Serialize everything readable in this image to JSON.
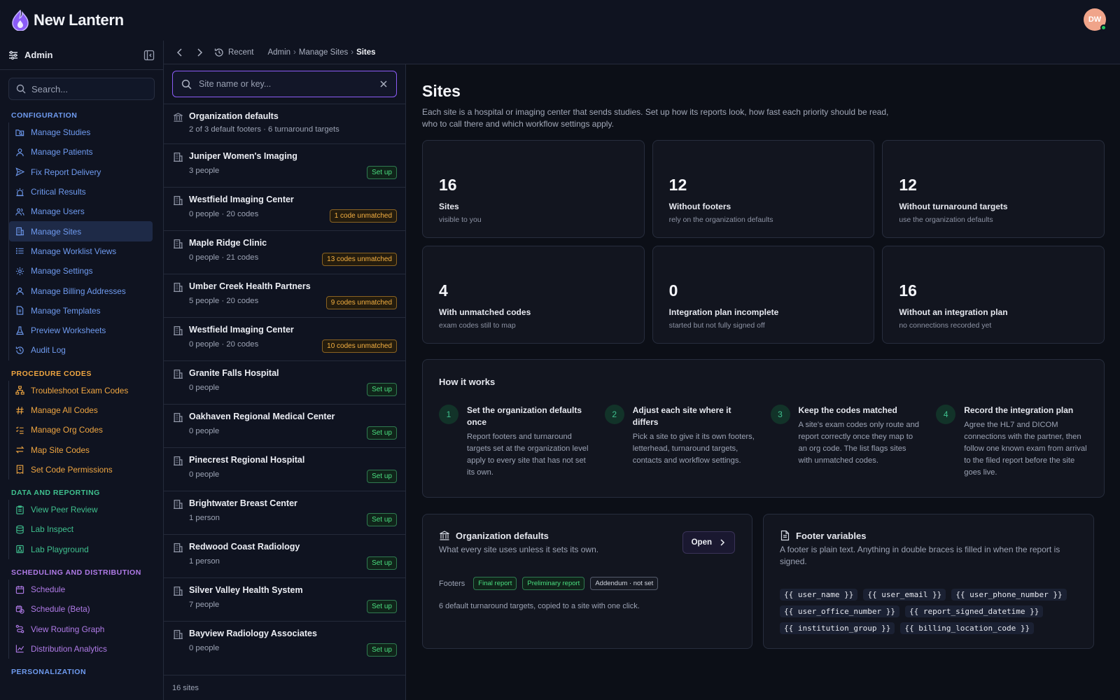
{
  "app": {
    "name": "New Lantern",
    "user_initials": "DW"
  },
  "sidebar": {
    "title": "Admin",
    "search_placeholder": "Search...",
    "sections": [
      {
        "title": "CONFIGURATION",
        "color": "#6f9bf0",
        "items": [
          {
            "label": "Manage Studies",
            "icon": "folder-search-icon"
          },
          {
            "label": "Manage Patients",
            "icon": "user-icon"
          },
          {
            "label": "Fix Report Delivery",
            "icon": "send-icon"
          },
          {
            "label": "Critical Results",
            "icon": "siren-icon"
          },
          {
            "label": "Manage Users",
            "icon": "users-icon"
          },
          {
            "label": "Manage Sites",
            "icon": "building-icon",
            "active": true
          },
          {
            "label": "Manage Worklist Views",
            "icon": "list-icon"
          },
          {
            "label": "Manage Settings",
            "icon": "gear-icon"
          },
          {
            "label": "Manage Billing Addresses",
            "icon": "user-pin-icon"
          },
          {
            "label": "Manage Templates",
            "icon": "file-icon"
          },
          {
            "label": "Preview Worksheets",
            "icon": "flask-icon"
          },
          {
            "label": "Audit Log",
            "icon": "history-icon"
          }
        ]
      },
      {
        "title": "PROCEDURE CODES",
        "color": "#f0a641",
        "items": [
          {
            "label": "Troubleshoot Exam Codes",
            "icon": "hierarchy-icon"
          },
          {
            "label": "Manage All Codes",
            "icon": "hash-icon"
          },
          {
            "label": "Manage Org Codes",
            "icon": "checklist-icon"
          },
          {
            "label": "Map Site Codes",
            "icon": "arrows-icon"
          },
          {
            "label": "Set Code Permissions",
            "icon": "receipt-icon"
          }
        ]
      },
      {
        "title": "DATA AND REPORTING",
        "color": "#3fc08e",
        "items": [
          {
            "label": "View Peer Review",
            "icon": "clipboard-icon"
          },
          {
            "label": "Lab Inspect",
            "icon": "database-icon"
          },
          {
            "label": "Lab Playground",
            "icon": "flask-box-icon"
          }
        ]
      },
      {
        "title": "SCHEDULING AND DISTRIBUTION",
        "color": "#b07be8",
        "items": [
          {
            "label": "Schedule",
            "icon": "calendar-icon"
          },
          {
            "label": "Schedule (Beta)",
            "icon": "calendar-clock-icon"
          },
          {
            "label": "View Routing Graph",
            "icon": "route-icon"
          },
          {
            "label": "Distribution Analytics",
            "icon": "chart-icon"
          }
        ]
      },
      {
        "title": "PERSONALIZATION",
        "color": "#6f9bf0",
        "items": []
      }
    ]
  },
  "breadcrumbs": {
    "recent": "Recent",
    "items": [
      "Admin",
      "Manage Sites"
    ],
    "current": "Sites"
  },
  "site_list": {
    "search_placeholder": "Site name or key...",
    "org_defaults": {
      "name": "Organization defaults",
      "sub": "2 of 3 default footers · 6 turnaround targets"
    },
    "sites": [
      {
        "name": "Juniper Women's Imaging",
        "sub": "3 people",
        "badge": "Set up",
        "kind": "green"
      },
      {
        "name": "Westfield Imaging Center",
        "sub": "0 people · 20 codes",
        "badge": "1 code unmatched",
        "kind": "amber"
      },
      {
        "name": "Maple Ridge Clinic",
        "sub": "0 people · 21 codes",
        "badge": "13 codes unmatched",
        "kind": "amber"
      },
      {
        "name": "Umber Creek Health Partners",
        "sub": "5 people · 20 codes",
        "badge": "9 codes unmatched",
        "kind": "amber"
      },
      {
        "name": "Westfield Imaging Center",
        "sub": "0 people · 20 codes",
        "badge": "10 codes unmatched",
        "kind": "amber"
      },
      {
        "name": "Granite Falls Hospital",
        "sub": "0 people",
        "badge": "Set up",
        "kind": "green"
      },
      {
        "name": "Oakhaven Regional Medical Center",
        "sub": "0 people",
        "badge": "Set up",
        "kind": "green"
      },
      {
        "name": "Pinecrest Regional Hospital",
        "sub": "0 people",
        "badge": "Set up",
        "kind": "green"
      },
      {
        "name": "Brightwater Breast Center",
        "sub": "1 person",
        "badge": "Set up",
        "kind": "green"
      },
      {
        "name": "Redwood Coast Radiology",
        "sub": "1 person",
        "badge": "Set up",
        "kind": "green"
      },
      {
        "name": "Silver Valley Health System",
        "sub": "7 people",
        "badge": "Set up",
        "kind": "green"
      },
      {
        "name": "Bayview Radiology Associates",
        "sub": "0 people",
        "badge": "Set up",
        "kind": "green"
      }
    ],
    "count_label": "16 sites"
  },
  "main": {
    "title": "Sites",
    "description": "Each site is a hospital or imaging center that sends studies. Set up how its reports look, how fast each priority should be read, who to call there and which workflow settings apply.",
    "stats": [
      {
        "value": "16",
        "label": "Sites",
        "sub": "visible to you"
      },
      {
        "value": "12",
        "label": "Without footers",
        "sub": "rely on the organization defaults"
      },
      {
        "value": "12",
        "label": "Without turnaround targets",
        "sub": "use the organization defaults"
      },
      {
        "value": "4",
        "label": "With unmatched codes",
        "sub": "exam codes still to map"
      },
      {
        "value": "0",
        "label": "Integration plan incomplete",
        "sub": "started but not fully signed off"
      },
      {
        "value": "16",
        "label": "Without an integration plan",
        "sub": "no connections recorded yet"
      }
    ],
    "how": {
      "title": "How it works",
      "steps": [
        {
          "num": "1",
          "title": "Set the organization defaults once",
          "text": "Report footers and turnaround targets set at the organization level apply to every site that has not set its own."
        },
        {
          "num": "2",
          "title": "Adjust each site where it differs",
          "text": "Pick a site to give it its own footers, letterhead, turnaround targets, contacts and workflow settings."
        },
        {
          "num": "3",
          "title": "Keep the codes matched",
          "text": "A site's exam codes only route and report correctly once they map to an org code. The list flags sites with unmatched codes."
        },
        {
          "num": "4",
          "title": "Record the integration plan",
          "text": "Agree the HL7 and DICOM connections with the partner, then follow one known exam from arrival to the filed report before the site goes live."
        }
      ]
    },
    "org_card": {
      "title": "Organization defaults",
      "sub": "What every site uses unless it sets its own.",
      "open_label": "Open",
      "footers_label": "Footers",
      "chips": [
        {
          "label": "Final report",
          "kind": "g"
        },
        {
          "label": "Preliminary report",
          "kind": "g"
        },
        {
          "label": "Addendum · not set",
          "kind": "n"
        }
      ],
      "turnaround_text": "6 default turnaround targets, copied to a site with one click."
    },
    "footer_card": {
      "title": "Footer variables",
      "sub": "A footer is plain text. Anything in double braces is filled in when the report is signed.",
      "vars": [
        "{{ user_name }}",
        "{{ user_email }}",
        "{{ user_phone_number }}",
        "{{ user_office_number }}",
        "{{ report_signed_datetime }}",
        "{{ institution_group }}",
        "{{ billing_location_code }}"
      ]
    }
  }
}
